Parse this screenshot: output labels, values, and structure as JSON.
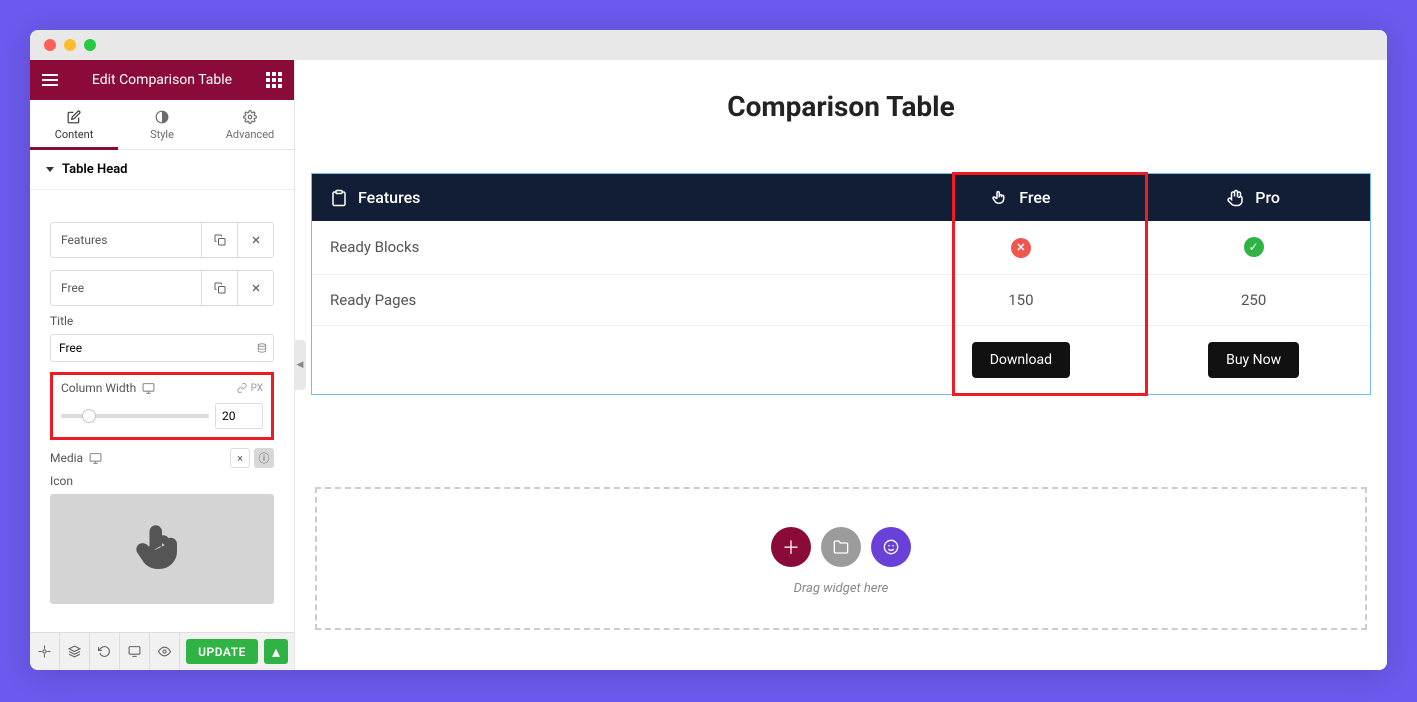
{
  "sidebar": {
    "title": "Edit Comparison Table",
    "tabs": [
      "Content",
      "Style",
      "Advanced"
    ],
    "section": "Table Head",
    "columns": [
      {
        "label": "Features"
      },
      {
        "label": "Free"
      }
    ],
    "props": {
      "title_label": "Title",
      "title_value": "Free",
      "column_width_label": "Column Width",
      "column_width_value": "20",
      "unit_px": "PX",
      "media_label": "Media",
      "icon_label": "Icon"
    },
    "footer": {
      "update": "UPDATE"
    }
  },
  "canvas": {
    "title": "Comparison Table",
    "headers": [
      {
        "label": "Features",
        "icon": "clipboard"
      },
      {
        "label": "Free",
        "icon": "pointer"
      },
      {
        "label": "Pro",
        "icon": "hand"
      }
    ],
    "rows": [
      {
        "feature": "Ready Blocks",
        "free": "x",
        "pro": "check"
      },
      {
        "feature": "Ready Pages",
        "free": "150",
        "pro": "250"
      }
    ],
    "buttons": {
      "free": "Download",
      "pro": "Buy Now"
    },
    "drop_hint": "Drag widget here"
  }
}
